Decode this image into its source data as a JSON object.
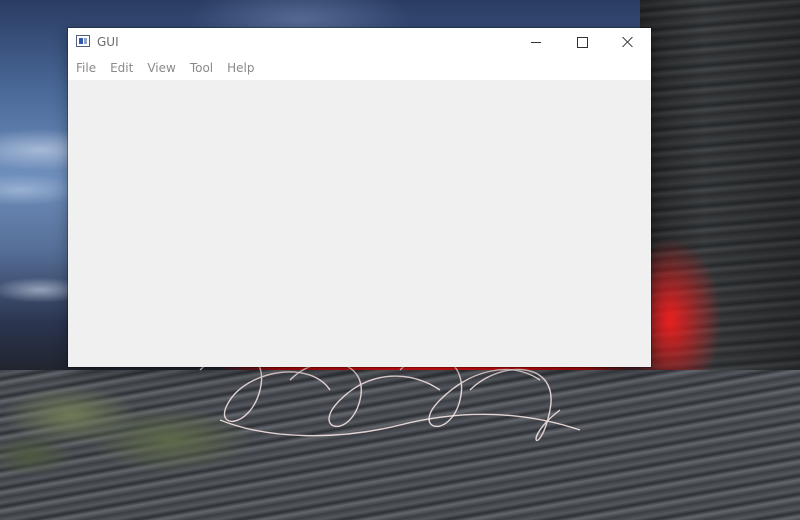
{
  "window": {
    "title": "GUI"
  },
  "menu": {
    "items": [
      {
        "label": "File"
      },
      {
        "label": "Edit"
      },
      {
        "label": "View"
      },
      {
        "label": "Tool"
      },
      {
        "label": "Help"
      }
    ]
  },
  "icons": {
    "app": "app-window-icon",
    "minimize": "minimize-icon",
    "maximize": "maximize-icon",
    "close": "close-icon"
  },
  "colors": {
    "titlebar": "#ffffff",
    "client": "#f0f0f0",
    "menu_text": "#8a8a8a"
  }
}
